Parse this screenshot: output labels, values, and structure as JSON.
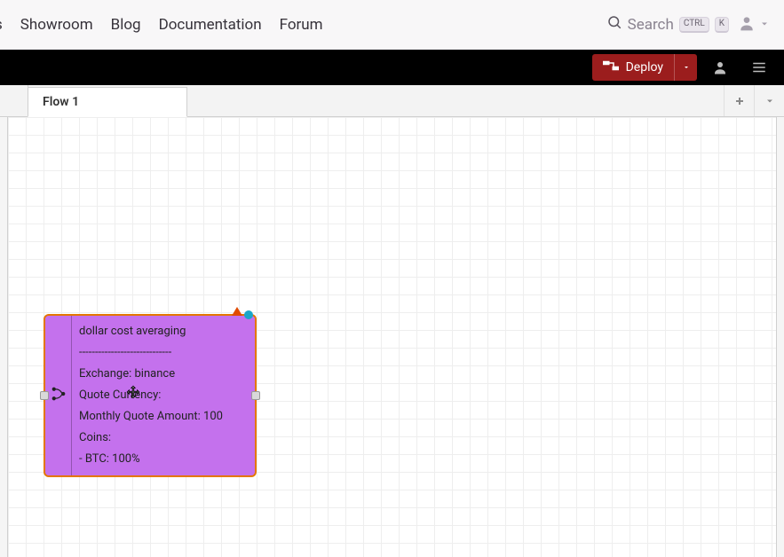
{
  "topnav": {
    "links": [
      "s",
      "Showroom",
      "Blog",
      "Documentation",
      "Forum"
    ],
    "search_placeholder": "Search",
    "kbd1": "CTRL",
    "kbd2": "K"
  },
  "toolbar": {
    "deploy_label": "Deploy"
  },
  "tabs": {
    "items": [
      {
        "label": "Flow 1"
      }
    ]
  },
  "node": {
    "title": "dollar cost averaging",
    "divider": "-----------------------------",
    "exchange_line": "Exchange: binance",
    "quote_currency_line": "Quote Currency:",
    "monthly_line": "Monthly Quote Amount: 100",
    "coins_line": "Coins:",
    "coin_alloc_line": "- BTC: 100%"
  }
}
